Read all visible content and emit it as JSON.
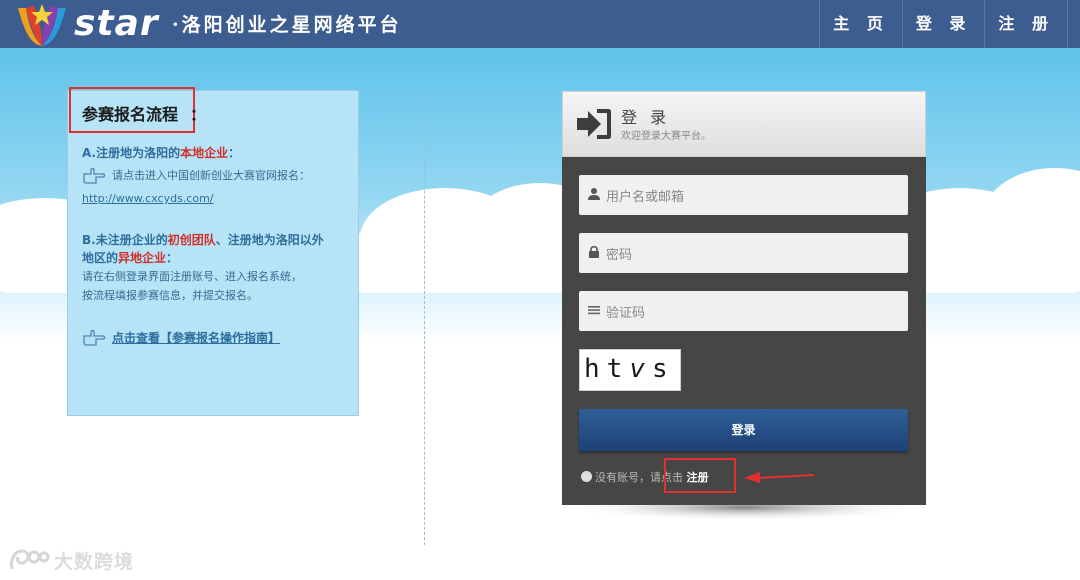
{
  "header": {
    "logo_text": "star",
    "logo_subtitle": "·洛阳创业之星网络平台",
    "nav": [
      "主 页",
      "登 录",
      "注 册"
    ]
  },
  "info": {
    "title": "参赛报名流程",
    "title_colon": "：",
    "section_a": {
      "prefix": "A.注册地为洛阳的",
      "highlight": "本地企业",
      "suffix": "："
    },
    "hint": "请点击进入中国创新创业大赛官网报名：",
    "link": "http://www.cxcyds.com/",
    "section_b": {
      "prefix": "B.未注册企业的",
      "highlight1": "初创团队",
      "middle": "、注册地为洛阳以外",
      "line2_prefix": "地区的",
      "highlight2": "异地企业",
      "line2_suffix": "："
    },
    "instruction_line1": "请在右侧登录界面注册账号、进入报名系统，",
    "instruction_line2": "按流程填报参赛信息，并提交报名。",
    "guide_link": "点击查看【参赛报名操作指南】"
  },
  "login": {
    "title": "登 录",
    "subtitle": "欢迎登录大赛平台。",
    "username_placeholder": "用户名或邮箱",
    "password_placeholder": "密码",
    "captcha_placeholder": "验证码",
    "captcha_chars": [
      "h",
      "t",
      "v",
      "s"
    ],
    "submit_label": "登录",
    "no_account_text": "没有账号，请点击",
    "register_link": "注册"
  },
  "watermark": "大数跨境",
  "colors": {
    "header_bg": "#3d5c8f",
    "panel_bg": "#464646",
    "button": "#2a5690",
    "highlight_red": "#d0302b",
    "annotation_red": "#e03030"
  }
}
